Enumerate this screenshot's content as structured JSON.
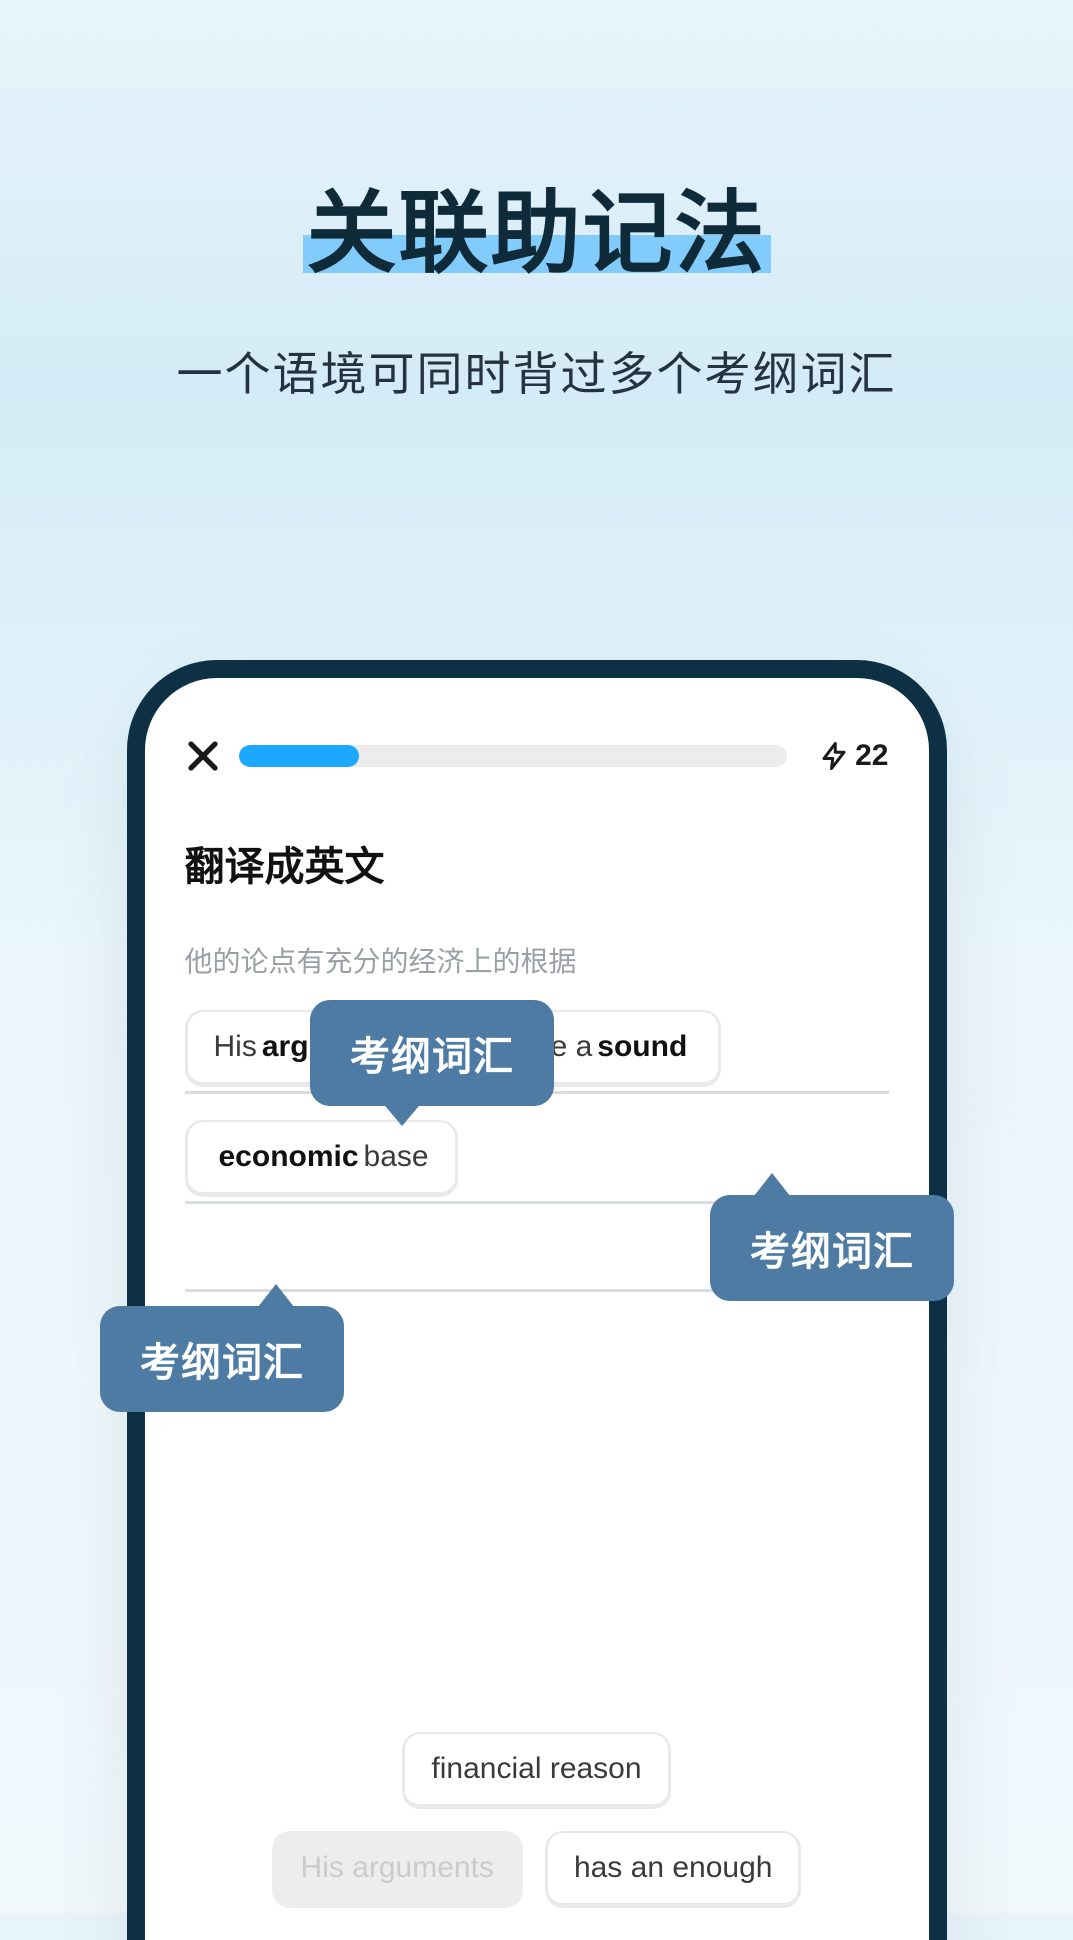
{
  "hero": {
    "title": "关联助记法",
    "subtitle": "一个语境可同时背过多个考纲词汇"
  },
  "lesson": {
    "energy_count": "22",
    "task_title": "翻译成英文",
    "prompt": "他的论点有充分的经济上的根据",
    "answer_chips": [
      {
        "prefix": "His ",
        "bold": "arguments",
        "suffix": ""
      },
      {
        "prefix": "have a ",
        "bold": "sound",
        "suffix": ""
      },
      {
        "prefix": "",
        "bold": "economic",
        "suffix": " base"
      }
    ],
    "options": [
      {
        "label": "financial reason",
        "ghost": false
      },
      {
        "label": "His arguments",
        "ghost": true
      },
      {
        "label": "has an enough",
        "ghost": false
      }
    ]
  },
  "tooltips": {
    "label": "考纲词汇"
  }
}
